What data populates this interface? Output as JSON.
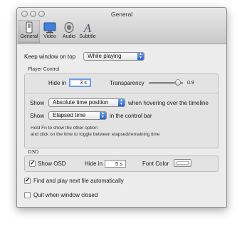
{
  "window": {
    "title": "General"
  },
  "toolbar": {
    "items": [
      {
        "label": "General",
        "icon": "general-switch-icon",
        "selected": true
      },
      {
        "label": "Video",
        "icon": "monitor-icon",
        "selected": false
      },
      {
        "label": "Audio",
        "icon": "speaker-icon",
        "selected": false
      },
      {
        "label": "Subtitle",
        "icon": "letter-a-icon",
        "selected": false
      }
    ]
  },
  "keep_on_top": {
    "label": "Keep window on top",
    "value": "While playing"
  },
  "player_control": {
    "group_label": "Player Control",
    "hide_in_label": "Hide in",
    "hide_in_value": "3 s",
    "transparency_label": "Transparency",
    "transparency_value": "0.9",
    "show1": {
      "label": "Show",
      "value": "Absolute time position",
      "suffix": "when hovering over the timeline"
    },
    "show2": {
      "label": "Show",
      "value": "Elapsed time",
      "suffix": "in the control bar"
    },
    "hint_line1": "Hold Fn to show the other option",
    "hint_line2": "and click on the time to toggle between elapsed/remaining time"
  },
  "osd": {
    "group_label": "OSD",
    "show_osd_label": "Show OSD",
    "show_osd_checked": true,
    "hide_in_label": "Hide in",
    "hide_in_value": "5 s",
    "font_color_label": "Font Color",
    "font_color": "#ffffff"
  },
  "find_next": {
    "label": "Find and play next file automatically",
    "checked": true
  },
  "quit_on_close": {
    "label": "Quit when window closed",
    "checked": false
  },
  "colors": {
    "accent": "#2a62c9",
    "window_bg": "#ececec"
  }
}
